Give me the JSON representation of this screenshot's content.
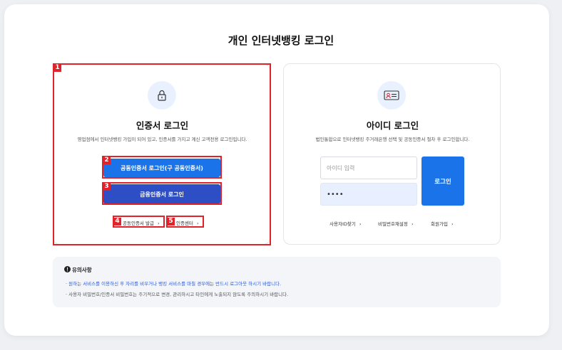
{
  "page_title": "개인 인터넷뱅킹 로그인",
  "cert_login": {
    "title": "인증서 로그인",
    "description": "영업점에서 인터넷뱅킹 가입이 되어 있고, 인증서를 가지고 계신 고객전용 로그인입니다.",
    "joint_cert_button": "공동인증서 로그인(구 공동인증서)",
    "financial_cert_button": "금융인증서 로그인",
    "issue_link": "공동인증서 발급",
    "center_link": "인증센터",
    "chevron": "›"
  },
  "id_login": {
    "title": "아이디 로그인",
    "description": "법인통합으로 인터넷뱅킹 주거래은행 선택 및 공동인증서 절차 후 로그인합니다.",
    "id_placeholder": "아이디 입력",
    "password_value": "••••",
    "login_button": "로그인",
    "find_id_link": "사용자ID찾기",
    "reset_password_link": "비밀번호재설정",
    "signup_link": "회원가입",
    "chevron": "›"
  },
  "notice": {
    "title": "유의사항",
    "line1": "원하는 서비스를 이용하신 후 자리를 비우거나 뱅킹 서비스를 마칠 경우에는 반드시 로그아웃 하시기 바랍니다.",
    "line2": "사용자 비밀번호/인증서 비밀번호는 주기적으로 변경, 관리하시고 타인에게 노출되지 않도록 주의하시기 바랍니다."
  },
  "annotations": [
    "1",
    "2",
    "3",
    "4",
    "5"
  ],
  "colors": {
    "primary_blue": "#1a73e8",
    "dark_blue": "#2d4ec4",
    "highlight_red": "#e0232b",
    "notice_blue": "#2a5bd7"
  },
  "icons": {
    "cert": "lock-icon",
    "id": "id-card-icon",
    "notice": "info-icon"
  }
}
